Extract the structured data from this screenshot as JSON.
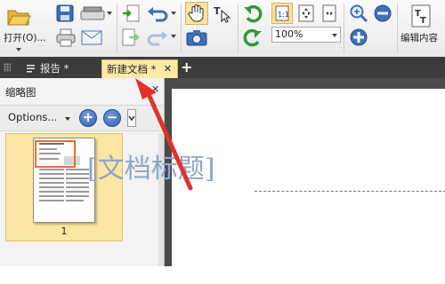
{
  "toolbar": {
    "open_label": "打开(O)...",
    "zoom_value": "100%",
    "edit_content_label": "编辑内容"
  },
  "tabs": [
    {
      "label": "报告 *"
    },
    {
      "label": "新建文档 *"
    }
  ],
  "panel": {
    "title": "缩略图",
    "options_label": "Options...",
    "zoom_in_symbol": "+",
    "zoom_out_symbol": "−",
    "page_number": "1"
  },
  "document": {
    "title_text": "[文档标题]"
  },
  "colors": {
    "active_tab": "#fde9a9",
    "tabbar": "#3c3c3c",
    "annotation_arrow": "#e0332b",
    "title_text": "#8fa6c8"
  },
  "icons": [
    "folder-open-icon",
    "save-icon",
    "scanner-icon",
    "print-icon",
    "email-icon",
    "page-insert-icon",
    "page-export-icon",
    "undo-icon",
    "redo-icon",
    "hand-tool-icon",
    "select-text-icon",
    "snapshot-icon",
    "rotate-left-icon",
    "rotate-right-icon",
    "actual-size-icon",
    "fit-page-icon",
    "fit-width-icon",
    "zoom-in-icon",
    "zoom-out-icon",
    "edit-content-icon"
  ]
}
